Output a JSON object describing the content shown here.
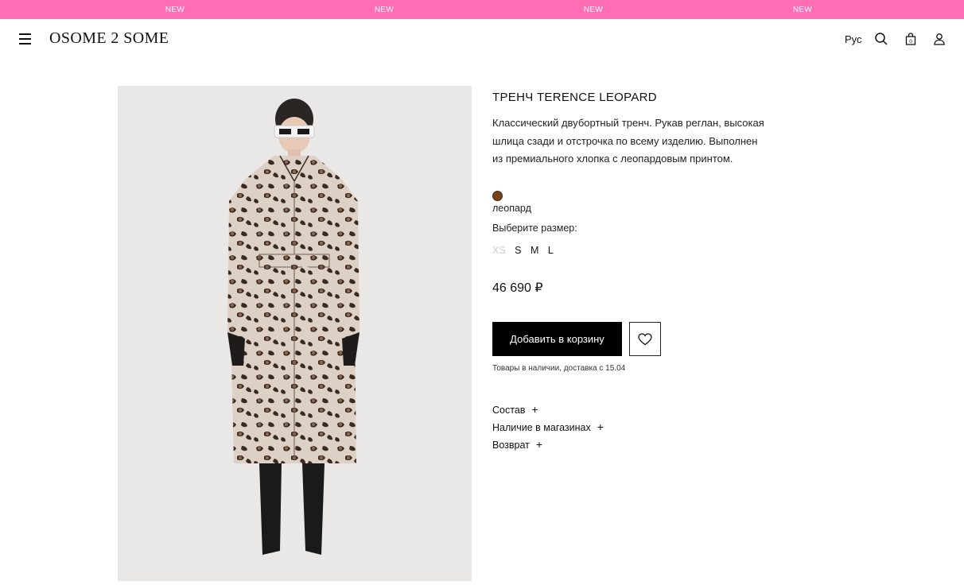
{
  "ticker": [
    "NEW",
    "NEW",
    "NEW",
    "NEW"
  ],
  "header": {
    "logo": "OSOME 2 SOME",
    "language": "Рус",
    "cart_count": "0",
    "icons": [
      "menu-icon",
      "search-icon",
      "bag-icon",
      "user-icon"
    ]
  },
  "product": {
    "title": "ТРЕНЧ TERENCE LEOPARD",
    "description": "Классический двубортный тренч. Рукав реглан, высокая шлица сзади и отстрочка по всему изделию. Выполнен из премиального хлопка с леопардовым принтом.",
    "color": {
      "name": "леопард",
      "swatch": "#7b3f10"
    },
    "size_label": "Выберите размер:",
    "sizes": [
      {
        "label": "XS",
        "available": false
      },
      {
        "label": "S",
        "available": true
      },
      {
        "label": "M",
        "available": true
      },
      {
        "label": "L",
        "available": true
      }
    ],
    "price": "46 690 ₽",
    "add_to_cart": "Добавить в корзину",
    "stock_note": "Товары в наличии, доставка с 15.04",
    "accordions": [
      {
        "label": "Состав",
        "icon": "+"
      },
      {
        "label": "Наличие в магазинах",
        "icon": "+"
      },
      {
        "label": "Возврат",
        "icon": "+"
      }
    ]
  },
  "colors": {
    "ticker_bg": "#ff6eb4",
    "button_bg": "#000000",
    "image_bg": "#e9e8e6"
  }
}
